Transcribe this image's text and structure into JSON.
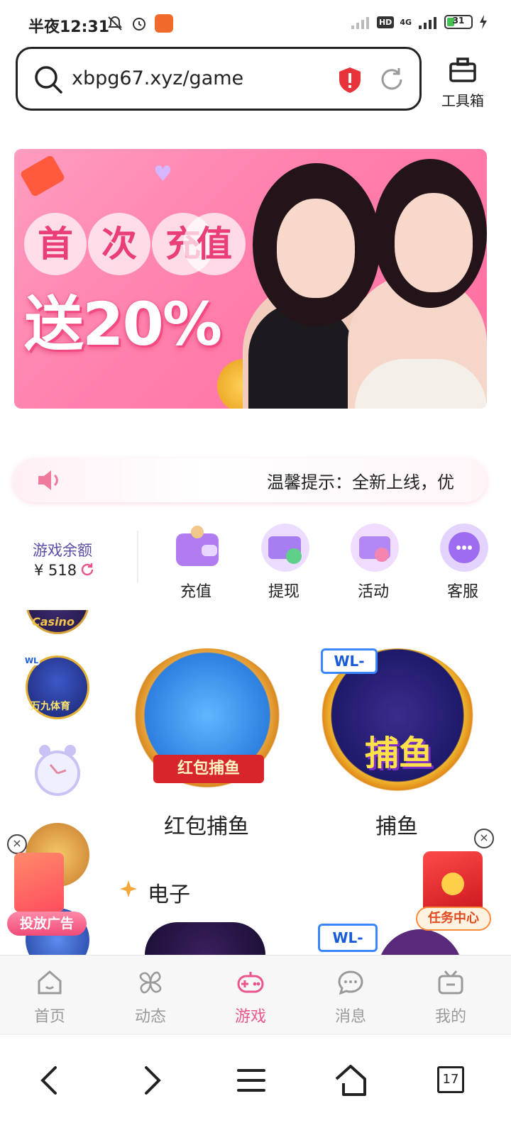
{
  "status_bar": {
    "time": "半夜12:31",
    "network": "4G",
    "hd": "HD",
    "battery": "31",
    "battery_level": 0.31
  },
  "browser": {
    "url": "xbpg67.xyz/game",
    "toolbox_label": "工具箱"
  },
  "banner": {
    "headline_chars": [
      "首",
      "次",
      "充",
      "值"
    ],
    "promo_text": "送20%"
  },
  "notice": {
    "text": "温馨提示：全新上线，优"
  },
  "wallet": {
    "balance_label": "游戏余额",
    "balance_value": "¥ 518"
  },
  "quick_actions": [
    {
      "label": "充值",
      "icon": "wallet-icon",
      "color": "#b07cf0"
    },
    {
      "label": "提现",
      "icon": "withdraw-card-icon",
      "color": "#a77ef2"
    },
    {
      "label": "活动",
      "icon": "event-card-icon",
      "color": "#b488f4"
    },
    {
      "label": "客服",
      "icon": "customer-service-icon",
      "color": "#9d6cf0"
    }
  ],
  "games": [
    {
      "label": "红包捕鱼",
      "art_badge": "红包捕鱼"
    },
    {
      "label": "捕鱼",
      "art_badge": "捕鱼"
    }
  ],
  "side_thumbs": [
    {
      "badge": "Casino"
    },
    {
      "badge": "WL"
    },
    {
      "badge": "万九体育"
    }
  ],
  "section": {
    "title": "电子"
  },
  "floating": {
    "ad_label": "投放广告",
    "task_label": "任务中心"
  },
  "tabs": [
    {
      "label": "首页",
      "icon": "home-icon"
    },
    {
      "label": "动态",
      "icon": "pinwheel-icon"
    },
    {
      "label": "游戏",
      "icon": "gamepad-icon",
      "active": true
    },
    {
      "label": "消息",
      "icon": "chat-bubble-icon"
    },
    {
      "label": "我的",
      "icon": "tv-icon"
    }
  ],
  "system_nav": {
    "tab_count": "17"
  },
  "colors": {
    "accent": "#e9558c",
    "banner_pink": "#ff7fad",
    "purple_label": "#5a4aa8"
  }
}
